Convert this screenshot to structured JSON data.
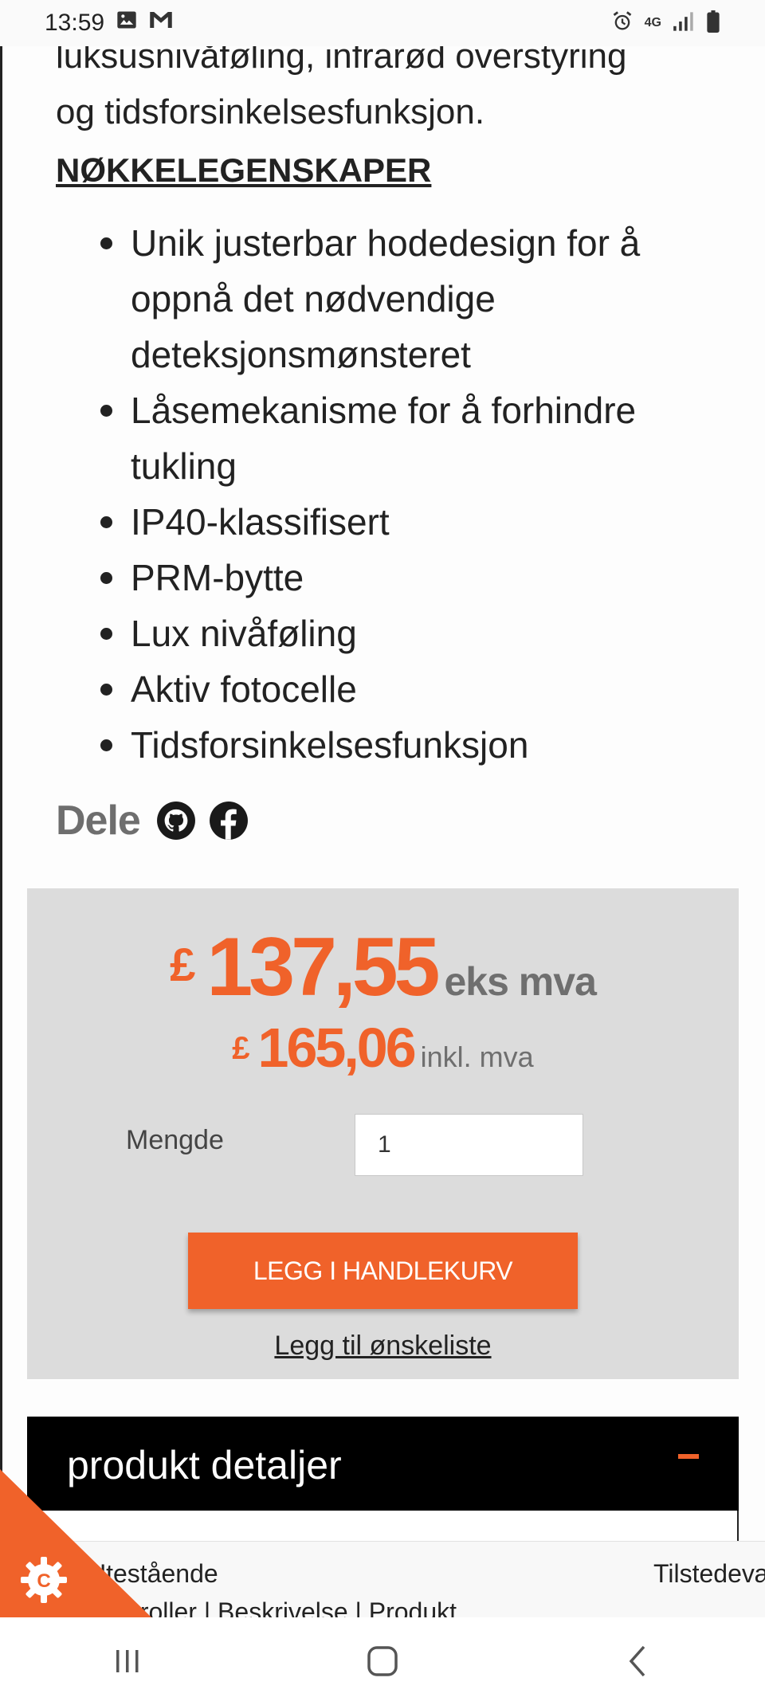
{
  "status_bar": {
    "time": "13:59",
    "network": "4G"
  },
  "product": {
    "intro_lines": [
      "luksusnivåføling, infrarød overstyring",
      "og tidsforsinkelsesfunksjon."
    ],
    "features_heading": "NØKKELEGENSKAPER",
    "features": [
      "Unik justerbar hodedesign for å oppnå det nødvendige deteksjonsmønsteret",
      "Låsemekanisme for å forhindre tukling",
      "IP40-klassifisert",
      "PRM-bytte",
      "Lux nivåføling",
      "Aktiv fotocelle",
      "Tidsforsinkelsesfunksjon"
    ],
    "share_label": "Dele"
  },
  "pricing": {
    "currency_symbol": "£",
    "price_ex_vat": "137,55",
    "ex_vat_label": "eks mva",
    "price_inc_vat": "165,06",
    "inc_vat_label": "inkl. mva",
    "quantity_label": "Mengde",
    "quantity_value": "1",
    "add_to_cart_label": "LEGG I HANDLEKURV",
    "wishlist_label": "Legg til ønskeliste"
  },
  "details_section": {
    "title": "produkt detaljer",
    "toggle_symbol": "–"
  },
  "cookie_bar": {
    "category_1": "Utestående",
    "category_2": "Tilstedeværelse",
    "links": "Kontroller | Beskrivelse | Produkt"
  },
  "colors": {
    "accent": "#f0622a",
    "price_box_bg": "#dcdcdc",
    "details_bar_bg": "#000000"
  },
  "icons": {
    "share": [
      "github-icon",
      "facebook-icon"
    ],
    "cookie": "cookie-settings-icon",
    "nav": [
      "recent-apps-icon",
      "home-icon",
      "back-icon"
    ]
  }
}
